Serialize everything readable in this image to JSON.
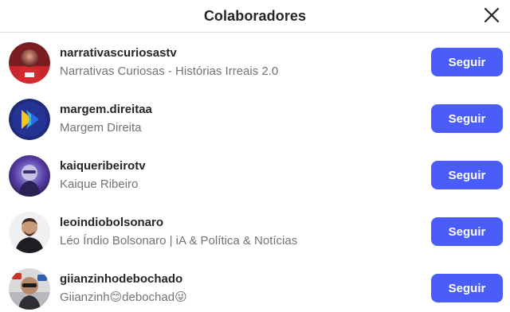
{
  "header": {
    "title": "Colaboradores",
    "close_icon": "close-icon"
  },
  "users": [
    {
      "username": "narrativascuriosastv",
      "fullname": "Narrativas Curiosas - Histórias Irreais 2.0",
      "button": "Seguir"
    },
    {
      "username": "margem.direitaa",
      "fullname": "Margem Direita",
      "button": "Seguir"
    },
    {
      "username": "kaiqueribeirotv",
      "fullname": "Kaique Ribeiro",
      "button": "Seguir"
    },
    {
      "username": "leoindiobolsonaro",
      "fullname": "Léo Índio Bolsonaro | iA & Política & Notícias",
      "button": "Seguir"
    },
    {
      "username": "giianzinhodebochado",
      "fullname": "Giianzinh😊debochad😜",
      "button": "Seguir"
    }
  ],
  "colors": {
    "button_bg": "#4a5df9",
    "username": "#262626",
    "fullname": "#737373"
  }
}
